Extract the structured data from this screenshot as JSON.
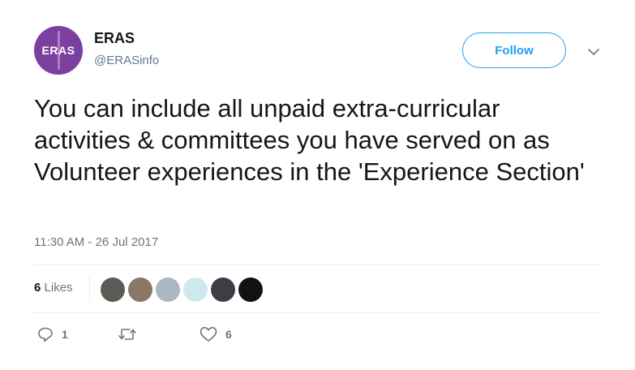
{
  "author": {
    "avatar_text": "ERAS",
    "name": "ERAS",
    "handle": "@ERASinfo"
  },
  "follow_label": "Follow",
  "tweet": {
    "text": "You can include all unpaid extra-curricular activities & committees you have served on as Volunteer experiences in the 'Experience Section'",
    "timestamp": "11:30 AM - 26 Jul 2017"
  },
  "stats": {
    "likes_count": "6",
    "likes_label": "Likes"
  },
  "likers": [
    {
      "name": "liker-1",
      "color": "#5d5a55"
    },
    {
      "name": "liker-2",
      "color": "#8a7766"
    },
    {
      "name": "liker-3",
      "color": "#aab8c2"
    },
    {
      "name": "liker-4",
      "color": "#cfe8ee"
    },
    {
      "name": "liker-5",
      "color": "#3b3f45"
    },
    {
      "name": "liker-6",
      "color": "#111111"
    }
  ],
  "actions": {
    "reply_count": "1",
    "retweet_count": "",
    "like_count": "6"
  },
  "colors": {
    "accent": "#1da1f2",
    "secondary_text": "#657786",
    "brand_purple": "#7b3fa0"
  },
  "icons": [
    "chevron-down-icon",
    "reply-icon",
    "retweet-icon",
    "heart-icon"
  ]
}
